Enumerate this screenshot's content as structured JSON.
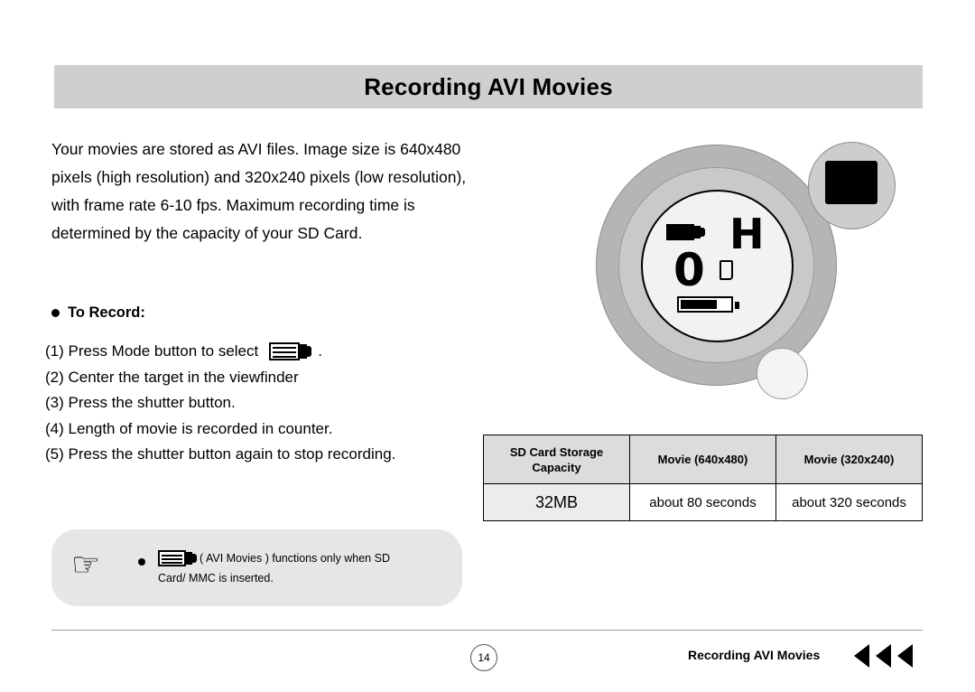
{
  "header": {
    "title": "Recording AVI Movies"
  },
  "intro": {
    "paragraph": "Your movies are stored as AVI files. Image size is 640x480 pixels (high resolution) and 320x240 pixels (low resolution), with frame rate 6-10 fps. Maximum recording time is determined by the capacity of your SD Card."
  },
  "section": {
    "heading": "To Record:"
  },
  "steps": [
    {
      "before": "(1) Press Mode button to select",
      "icon": "movie-camera-icon",
      "after": "."
    },
    {
      "before": "(2) Center the target in the viewfinder",
      "icon": "",
      "after": ""
    },
    {
      "before": "(3) Press the shutter button.",
      "icon": "",
      "after": ""
    },
    {
      "before": "(4) Length of movie is recorded in counter.",
      "icon": "",
      "after": ""
    },
    {
      "before": "(5) Press the shutter button again to stop recording.",
      "icon": "",
      "after": ""
    }
  ],
  "camera_display": {
    "mode_icon": "movie-camera-icon",
    "resolution_letter": "H",
    "counter": "0",
    "card_icon": "sd-card-icon",
    "battery_icon": "battery-icon"
  },
  "table": {
    "headers": [
      "SD Card Storage Capacity",
      "Movie (640x480)",
      "Movie (320x240)"
    ],
    "header_line1": "SD Card Storage",
    "header_line2": "Capacity",
    "rows": [
      [
        "32MB",
        "about 80 seconds",
        "about 320 seconds"
      ]
    ]
  },
  "note": {
    "hand_icon": "pointing-hand-icon",
    "icon": "movie-camera-icon",
    "line1": "( AVI Movies ) functions only when SD",
    "line2": "Card/ MMC is inserted."
  },
  "footer": {
    "page_number": "14",
    "title": "Recording AVI Movies",
    "arrows": 3
  }
}
